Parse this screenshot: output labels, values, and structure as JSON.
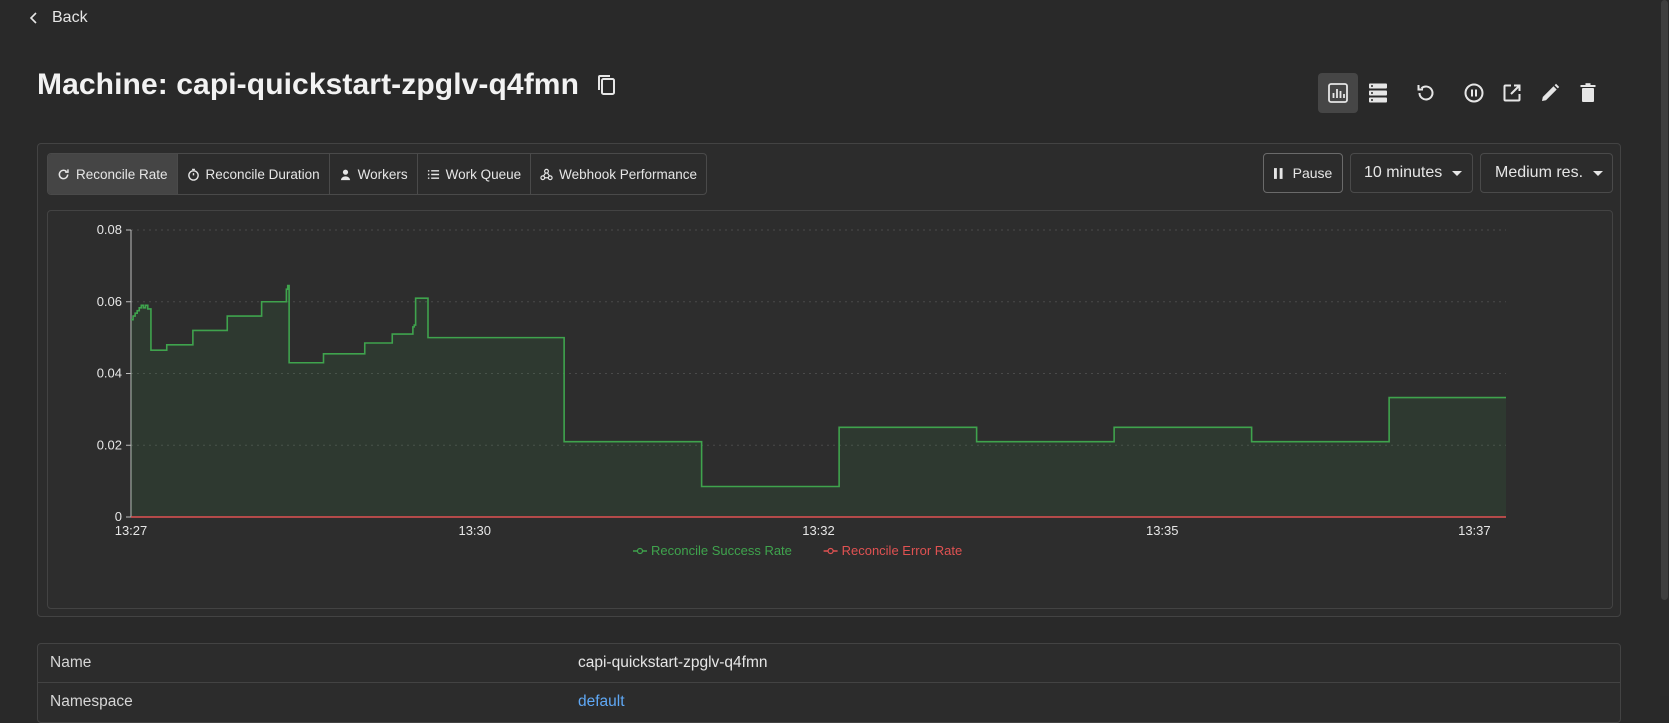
{
  "nav": {
    "back_label": "Back"
  },
  "header": {
    "title": "Machine: capi-quickstart-zpglv-q4fmn",
    "actions": [
      "chart-view",
      "table-view",
      "restart",
      "pause",
      "open-external",
      "edit",
      "delete"
    ]
  },
  "metrics": {
    "tabs": [
      {
        "label": "Reconcile Rate",
        "icon": "refresh-icon",
        "active": true
      },
      {
        "label": "Reconcile Duration",
        "icon": "stopwatch-icon",
        "active": false
      },
      {
        "label": "Workers",
        "icon": "worker-icon",
        "active": false
      },
      {
        "label": "Work Queue",
        "icon": "list-icon",
        "active": false
      },
      {
        "label": "Webhook Performance",
        "icon": "webhook-icon",
        "active": false
      }
    ],
    "pause_label": "Pause",
    "time_range": "10 minutes",
    "resolution": "Medium res."
  },
  "chart_data": {
    "type": "line",
    "step": true,
    "ylim": [
      0,
      0.08
    ],
    "yticks": [
      "0",
      "0.02",
      "0.04",
      "0.06",
      "0.08"
    ],
    "xticks": [
      "13:27",
      "13:30",
      "13:32",
      "13:35",
      "13:37"
    ],
    "grid": true,
    "legend_position": "bottom",
    "series": [
      {
        "name": "Reconcile Success Rate",
        "color": "#3fa34d",
        "points": [
          [
            0.0,
            0.055
          ],
          [
            0.0015,
            0.056
          ],
          [
            0.003,
            0.0568
          ],
          [
            0.0045,
            0.0575
          ],
          [
            0.006,
            0.0583
          ],
          [
            0.0075,
            0.059
          ],
          [
            0.009,
            0.0583
          ],
          [
            0.0105,
            0.059
          ],
          [
            0.0122,
            0.058
          ],
          [
            0.0145,
            0.0465
          ],
          [
            0.026,
            0.048
          ],
          [
            0.045,
            0.052
          ],
          [
            0.07,
            0.056
          ],
          [
            0.095,
            0.06
          ],
          [
            0.113,
            0.0635
          ],
          [
            0.114,
            0.0645
          ],
          [
            0.115,
            0.043
          ],
          [
            0.14,
            0.0455
          ],
          [
            0.17,
            0.0485
          ],
          [
            0.19,
            0.051
          ],
          [
            0.205,
            0.053
          ],
          [
            0.206,
            0.0535
          ],
          [
            0.207,
            0.061
          ],
          [
            0.215,
            0.061
          ],
          [
            0.216,
            0.05
          ],
          [
            0.314,
            0.05
          ],
          [
            0.315,
            0.021
          ],
          [
            0.414,
            0.021
          ],
          [
            0.415,
            0.0085
          ],
          [
            0.514,
            0.0085
          ],
          [
            0.515,
            0.025
          ],
          [
            0.614,
            0.025
          ],
          [
            0.615,
            0.021
          ],
          [
            0.714,
            0.021
          ],
          [
            0.715,
            0.025
          ],
          [
            0.814,
            0.025
          ],
          [
            0.815,
            0.021
          ],
          [
            0.914,
            0.021
          ],
          [
            0.915,
            0.0333
          ],
          [
            1.0,
            0.0333
          ]
        ]
      },
      {
        "name": "Reconcile Error Rate",
        "color": "#e05252",
        "points": [
          [
            0.0,
            0.0
          ],
          [
            1.0,
            0.0
          ]
        ]
      }
    ]
  },
  "details": {
    "rows": [
      {
        "key": "Name",
        "value": "capi-quickstart-zpglv-q4fmn"
      },
      {
        "key": "Namespace",
        "value": "default"
      }
    ]
  }
}
